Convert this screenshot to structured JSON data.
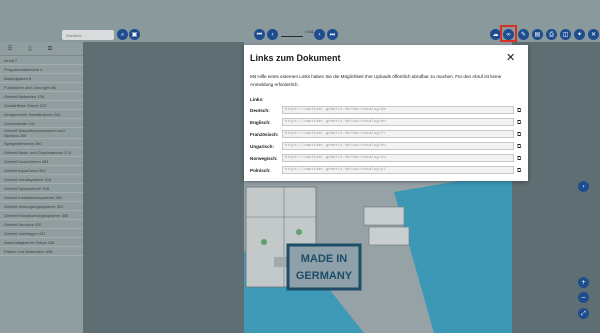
{
  "search": {
    "placeholder": "Suchtext"
  },
  "pager": {
    "current": "",
    "total": "/ 441"
  },
  "icons": {
    "search": "search-icon",
    "gallery": "image-gallery-icon",
    "first_page": "skip-back-icon",
    "prev_page": "chevron-left-icon",
    "next_page": "chevron-right-icon",
    "last_page": "skip-forward-icon",
    "cloud": "cloud-download-icon",
    "link": "link-icon",
    "edit": "pencil-icon",
    "book": "book-icon",
    "print": "print-icon",
    "bag": "shopping-bag-icon",
    "tools": "tools-icon",
    "close": "close-icon",
    "copy": "copy-icon",
    "zoom_in": "zoom-in-icon",
    "zoom_out": "zoom-out-icon"
  },
  "colors": {
    "accent": "#1e4d8f",
    "highlight": "#d93025",
    "topbar": "#8a9a9c",
    "sidebar": "#909e9f"
  },
  "sidebar": {
    "items": [
      {
        "label": "Inhalt 2"
      },
      {
        "label": "Programmübersicht 4"
      },
      {
        "label": "Bauaufgaben 8"
      },
      {
        "label": "Funktionen und Lösungen 86"
      },
      {
        "label": "Geberit Badserien 108"
      },
      {
        "label": "Sanitärfliese Ebene 222"
      },
      {
        "label": "Kindgerechte Sanitärräume 226"
      },
      {
        "label": "Duschwände 240"
      },
      {
        "label": "Geberit Waschtischarmaturen und Siphons 255"
      },
      {
        "label": "Spiegelelemente 260"
      },
      {
        "label": "Geberit Bade- und Duschwannen 274"
      },
      {
        "label": "Geberit Duschrinnen 284"
      },
      {
        "label": "Geberit AquaClean 304"
      },
      {
        "label": "Geberit Urinalsysteme 316"
      },
      {
        "label": "Geberit Spülsysteme 328"
      },
      {
        "label": "Geberit Installationssysteme 350"
      },
      {
        "label": "Geberit Versorgungssysteme 393"
      },
      {
        "label": "Geberit Entwässerungssysteme 408"
      },
      {
        "label": "Geberit Services 420"
      },
      {
        "label": "Geberit Unterlagen 421"
      },
      {
        "label": "Nachhaltigkeit im Fokus 428"
      },
      {
        "label": "Fakten und Materialien 436"
      }
    ]
  },
  "page": {
    "stamp_line1": "MADE IN",
    "stamp_line2": "GERMANY"
  },
  "dialog": {
    "title": "Links zum Dokument",
    "close_label": "✕",
    "description": "Mit Hilfe eines externen Links haben Sie die Möglichkeit Ihre Uploads öffentlich abrufbar zu machen. Für den Abruf ist keine Anmeldung erforderlich.",
    "links_label": "Links:",
    "rows": [
      {
        "language": "Deutsch:",
        "url": "https://sanitaer.geberit.de/doc/catalog/de"
      },
      {
        "language": "Englisch:",
        "url": "https://sanitaer.geberit.de/doc/catalog/en"
      },
      {
        "language": "Französisch:",
        "url": "https://sanitaer.geberit.de/doc/catalog/fr"
      },
      {
        "language": "Ungarisch:",
        "url": "https://sanitaer.geberit.de/doc/catalog/hu"
      },
      {
        "language": "Norwegisch:",
        "url": "https://sanitaer.geberit.de/doc/catalog/no"
      },
      {
        "language": "Polnisch:",
        "url": "https://sanitaer.geberit.de/doc/catalog/pl"
      }
    ]
  }
}
